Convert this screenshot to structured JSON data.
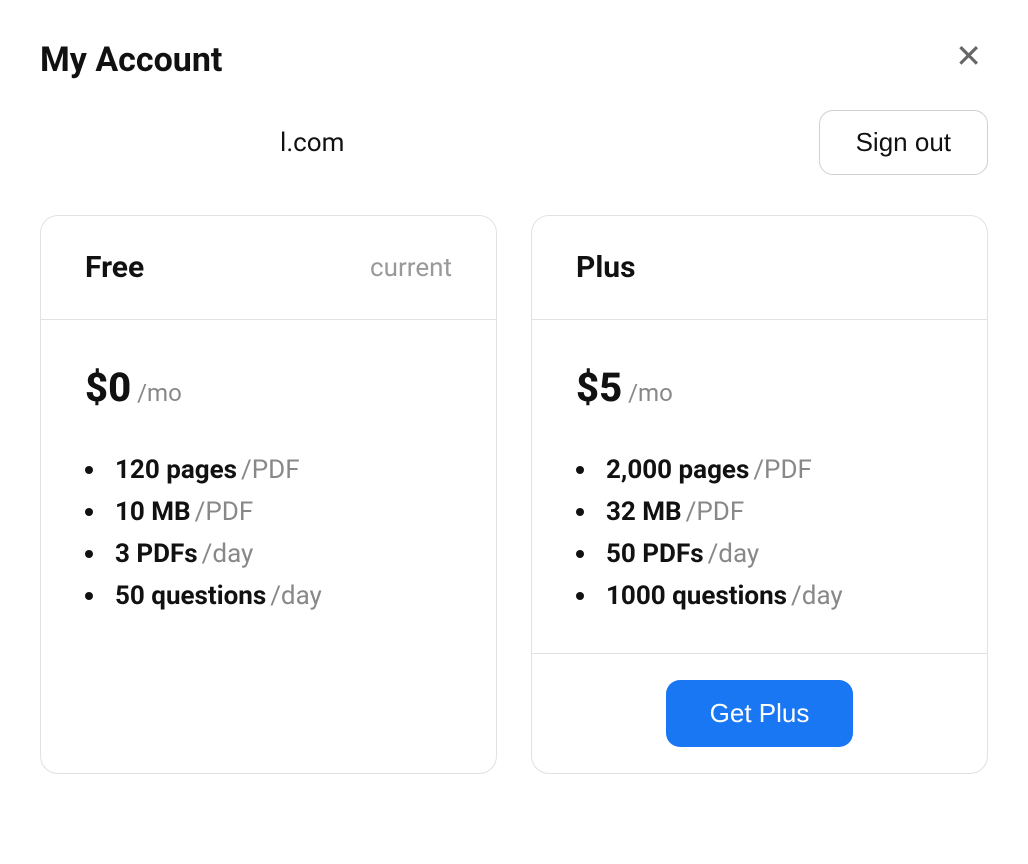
{
  "header": {
    "title": "My Account"
  },
  "account": {
    "email": "l.com",
    "signout_label": "Sign out"
  },
  "plans": [
    {
      "name": "Free",
      "badge": "current",
      "price": "$0",
      "period": "/mo",
      "features": [
        {
          "value": "120 pages",
          "unit": "/PDF"
        },
        {
          "value": "10 MB",
          "unit": "/PDF"
        },
        {
          "value": "3 PDFs",
          "unit": "/day"
        },
        {
          "value": "50 questions",
          "unit": "/day"
        }
      ],
      "cta": null
    },
    {
      "name": "Plus",
      "badge": "",
      "price": "$5",
      "period": "/mo",
      "features": [
        {
          "value": "2,000 pages",
          "unit": "/PDF"
        },
        {
          "value": "32 MB",
          "unit": "/PDF"
        },
        {
          "value": "50 PDFs",
          "unit": "/day"
        },
        {
          "value": "1000 questions",
          "unit": "/day"
        }
      ],
      "cta": "Get Plus"
    }
  ]
}
